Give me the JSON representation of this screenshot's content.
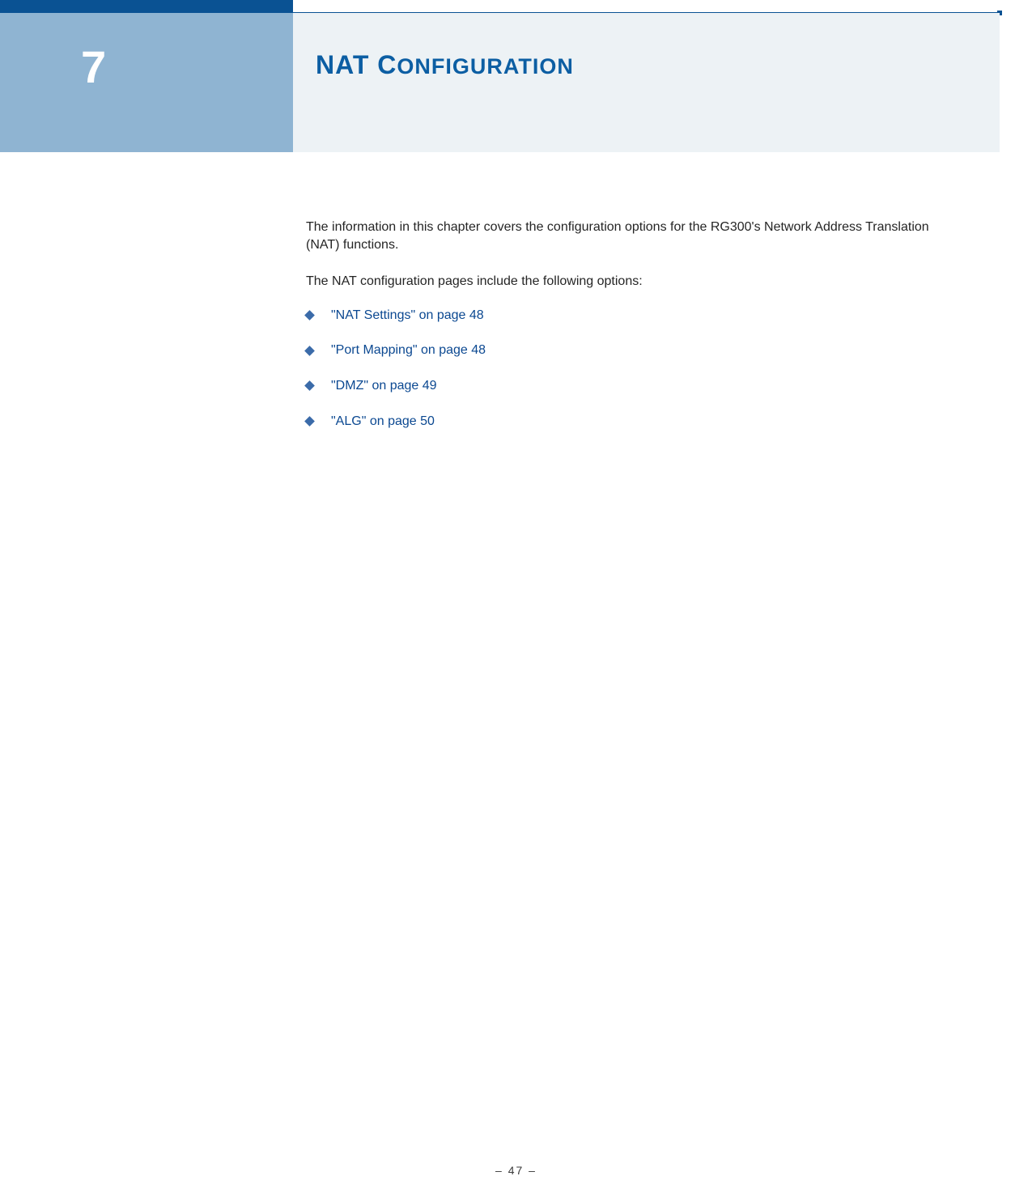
{
  "header": {
    "chapter_number": "7",
    "title_prefix": "NAT C",
    "title_suffix": "ONFIGURATION"
  },
  "content": {
    "intro_line1": "The information in this chapter covers the configuration options for the RG300's Network Address Translation (NAT) functions.",
    "intro_line2": "The NAT configuration pages include the following options:",
    "links": [
      "\"NAT Settings\" on page 48",
      "\"Port Mapping\" on page 48",
      "\"DMZ\" on page 49",
      "\"ALG\" on page 50"
    ]
  },
  "footer": {
    "page_number": "–  47  –"
  }
}
